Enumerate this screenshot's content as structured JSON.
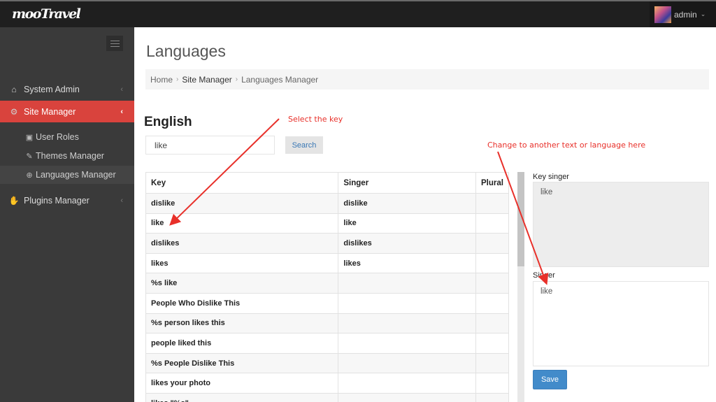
{
  "app": {
    "logo": "mooTravel"
  },
  "user": {
    "name": "admin",
    "caret": "⌄"
  },
  "sidebar": {
    "items": [
      {
        "label": "System Admin",
        "icon": "⌂",
        "chevron": "‹"
      },
      {
        "label": "Site Manager",
        "icon": "⚙",
        "chevron": "‹"
      },
      {
        "label": "Plugins Manager",
        "icon": "✋",
        "chevron": "‹"
      }
    ],
    "subitems": [
      {
        "label": "User Roles",
        "icon": "▣"
      },
      {
        "label": "Themes Manager",
        "icon": "✎"
      },
      {
        "label": "Languages Manager",
        "icon": "⊕"
      }
    ]
  },
  "page": {
    "title": "Languages",
    "breadcrumb": [
      "Home",
      "Site Manager",
      "Languages Manager"
    ],
    "breadcrumb_sep": "›",
    "section_title": "English"
  },
  "search": {
    "value": "like",
    "button": "Search"
  },
  "table": {
    "headers": [
      "Key",
      "Singer",
      "Plural"
    ],
    "rows": [
      [
        "dislike",
        "dislike",
        ""
      ],
      [
        "like",
        "like",
        ""
      ],
      [
        "dislikes",
        "dislikes",
        ""
      ],
      [
        "likes",
        "likes",
        ""
      ],
      [
        "%s like",
        "",
        ""
      ],
      [
        "People Who Dislike This",
        "",
        ""
      ],
      [
        "%s person likes this",
        "",
        ""
      ],
      [
        "people liked this",
        "",
        ""
      ],
      [
        "%s People Dislike This",
        "",
        ""
      ],
      [
        "likes your photo",
        "",
        ""
      ],
      [
        "likes \"%s\"",
        "",
        ""
      ]
    ],
    "scroll_fraction_visible": 0.41
  },
  "editor": {
    "key_singer_label": "Key singer",
    "key_singer_value": "like",
    "singer_label": "Singer",
    "singer_value": "like",
    "save": "Save"
  },
  "annotations": {
    "select_key": "Select the key",
    "change_text": "Change to another text or language here",
    "color": "#e8302a"
  },
  "colors": {
    "accent": "#d9433d",
    "primary": "#428bca",
    "topbar": "#1f1f1f",
    "sidebar": "#3a3a3a"
  }
}
